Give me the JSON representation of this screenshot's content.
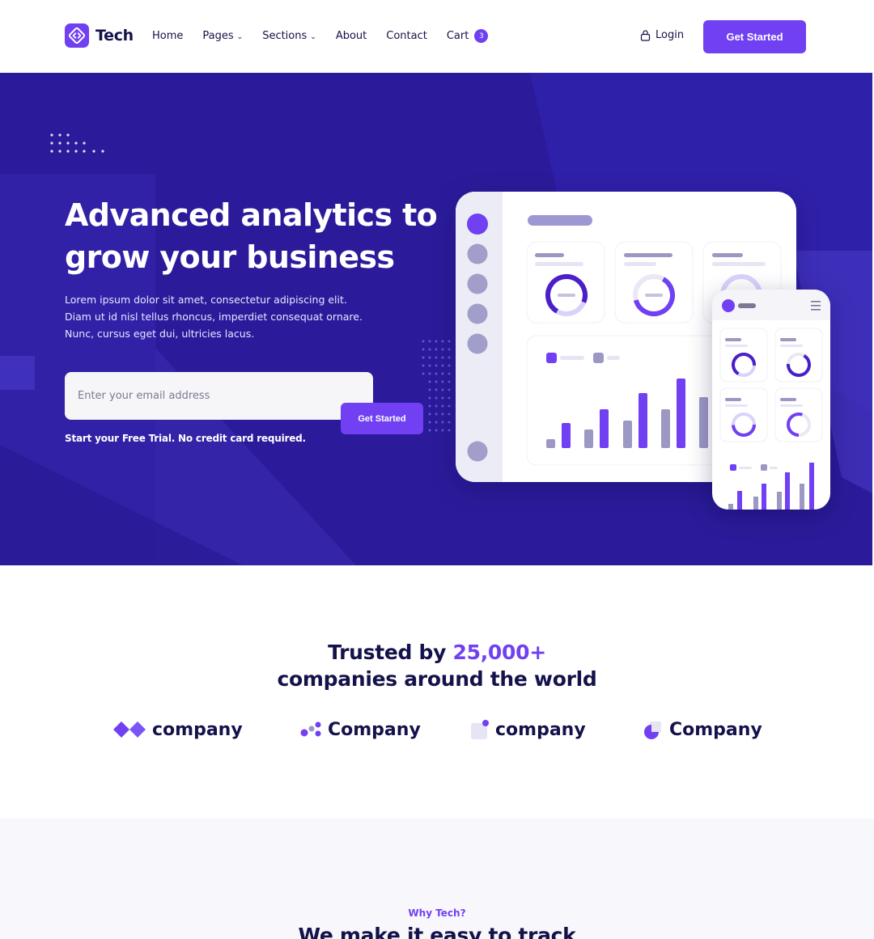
{
  "brand": {
    "name": "Tech",
    "accent": "#7040f2",
    "hero_bg": "#2b1b9a",
    "text_dark": "#14124a"
  },
  "nav": {
    "items": [
      {
        "label": "Home"
      },
      {
        "label": "Pages"
      },
      {
        "label": "Sections"
      },
      {
        "label": "About"
      },
      {
        "label": "Contact"
      },
      {
        "label": "Cart"
      }
    ],
    "cart_count": "3",
    "login_label": "Login",
    "cta_label": "Get Started"
  },
  "hero": {
    "title": "Advanced analytics to grow your business",
    "description": "Lorem ipsum dolor sit amet, consectetur adipiscing elit. Diam ut id nisl tellus rhoncus, imperdiet consequat ornare. Nunc, cursus eget dui, ultricies lacus.",
    "email_placeholder": "Enter your email address",
    "button_label": "Get Started",
    "note": "Start your Free Trial. No credit card required."
  },
  "trusted": {
    "prefix": "Trusted by ",
    "count": "25,000+",
    "suffix": "companies around the world",
    "companies": [
      {
        "name": "company",
        "icon": "diamond-logo-icon"
      },
      {
        "name": "Company",
        "icon": "dots-logo-icon"
      },
      {
        "name": "company",
        "icon": "square-dot-logo-icon"
      },
      {
        "name": "Company",
        "icon": "pie-logo-icon"
      }
    ]
  },
  "why": {
    "eyebrow": "Why Tech?",
    "title": "We make it easy to track"
  }
}
